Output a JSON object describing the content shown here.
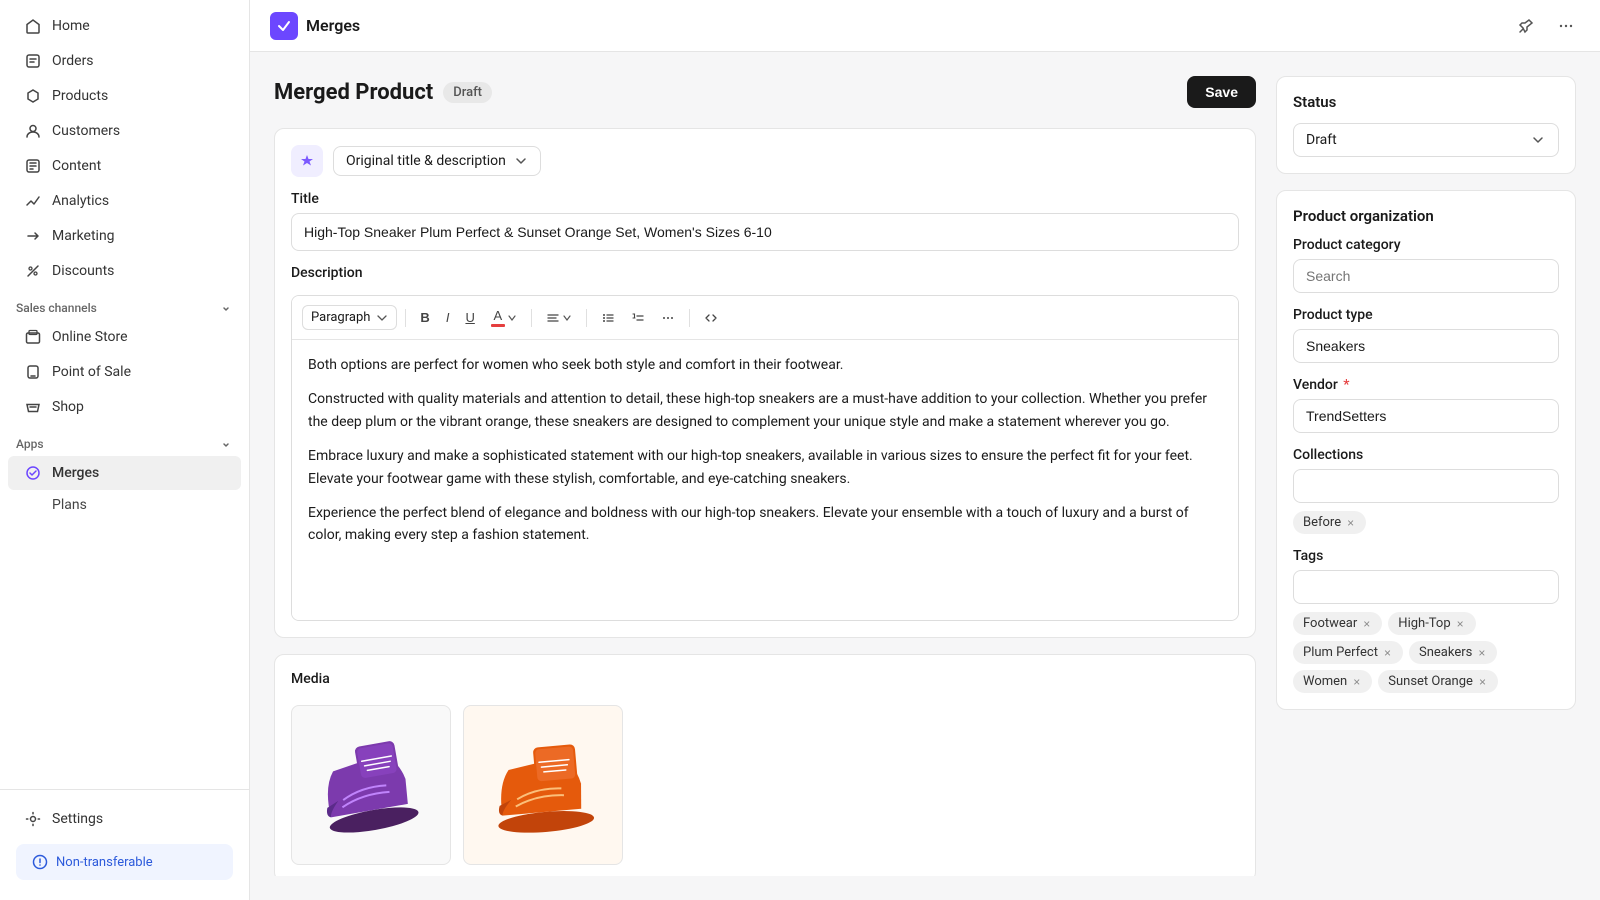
{
  "app": {
    "name": "Merges",
    "icon_color": "#6c47ff"
  },
  "sidebar": {
    "nav_items": [
      {
        "id": "home",
        "label": "Home",
        "icon": "home"
      },
      {
        "id": "orders",
        "label": "Orders",
        "icon": "orders"
      },
      {
        "id": "products",
        "label": "Products",
        "icon": "products"
      },
      {
        "id": "customers",
        "label": "Customers",
        "icon": "customers"
      },
      {
        "id": "content",
        "label": "Content",
        "icon": "content"
      },
      {
        "id": "analytics",
        "label": "Analytics",
        "icon": "analytics"
      },
      {
        "id": "marketing",
        "label": "Marketing",
        "icon": "marketing"
      },
      {
        "id": "discounts",
        "label": "Discounts",
        "icon": "discounts"
      }
    ],
    "sales_channels_label": "Sales channels",
    "sales_channel_items": [
      {
        "id": "online-store",
        "label": "Online Store"
      },
      {
        "id": "point-of-sale",
        "label": "Point of Sale"
      },
      {
        "id": "shop",
        "label": "Shop"
      }
    ],
    "apps_label": "Apps",
    "app_items": [
      {
        "id": "merges",
        "label": "Merges",
        "active": true
      },
      {
        "id": "plans",
        "label": "Plans"
      }
    ],
    "settings_label": "Settings",
    "non_transferable_label": "Non-transferable"
  },
  "page": {
    "title": "Merged Product",
    "status_badge": "Draft",
    "save_button": "Save"
  },
  "product_form": {
    "ai_dropdown_label": "Original title & description",
    "title_label": "Title",
    "title_value": "High-Top Sneaker Plum Perfect & Sunset Orange Set, Women's Sizes 6-10",
    "description_label": "Description",
    "paragraph_select": "Paragraph",
    "description_paragraphs": [
      "Both options are perfect for women who seek both style and comfort in their footwear.",
      "Constructed with quality materials and attention to detail, these high-top sneakers are a must-have addition to your collection. Whether you prefer the deep plum or the vibrant orange, these sneakers are designed to complement your unique style and make a statement wherever you go.",
      "Embrace luxury and make a sophisticated statement with our high-top sneakers, available in various sizes to ensure the perfect fit for your feet. Elevate your footwear game with these stylish, comfortable, and eye-catching sneakers.",
      "Experience the perfect blend of elegance and boldness with our high-top sneakers. Elevate your ensemble with a touch of luxury and a burst of color, making every step a fashion statement."
    ],
    "media_label": "Media"
  },
  "right_panel": {
    "status_section_title": "Status",
    "status_value": "Draft",
    "product_org_title": "Product organization",
    "product_category_label": "Product category",
    "product_category_placeholder": "Search",
    "product_type_label": "Product type",
    "product_type_value": "Sneakers",
    "vendor_label": "Vendor",
    "vendor_value": "TrendSetters",
    "collections_label": "Collections",
    "collections_tag": "Before",
    "tags_label": "Tags",
    "tags": [
      "Footwear",
      "High-Top",
      "Plum Perfect",
      "Sneakers",
      "Women",
      "Sunset Orange"
    ]
  }
}
